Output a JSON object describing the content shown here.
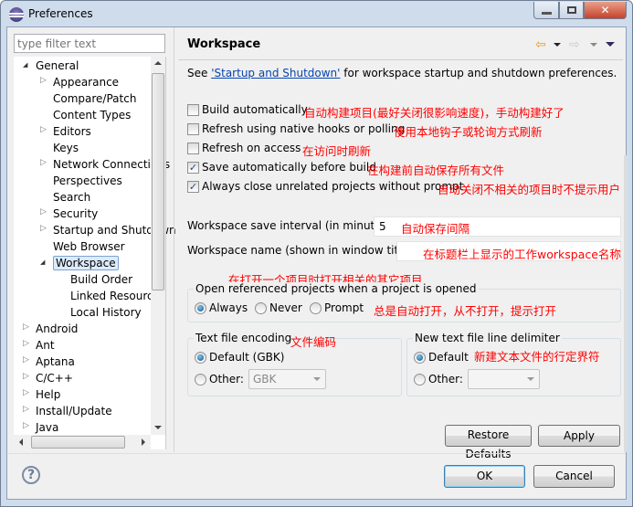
{
  "window": {
    "title": "Preferences",
    "minimize": "minimize",
    "maximize": "maximize",
    "close": "close"
  },
  "sidebar": {
    "filter_placeholder": "type filter text",
    "items": [
      {
        "label": "General",
        "level": 0,
        "expander": "expanded"
      },
      {
        "label": "Appearance",
        "level": 1,
        "expander": "collapsed"
      },
      {
        "label": "Compare/Patch",
        "level": 1,
        "expander": "none"
      },
      {
        "label": "Content Types",
        "level": 1,
        "expander": "none"
      },
      {
        "label": "Editors",
        "level": 1,
        "expander": "collapsed"
      },
      {
        "label": "Keys",
        "level": 1,
        "expander": "none"
      },
      {
        "label": "Network Connections",
        "level": 1,
        "expander": "collapsed"
      },
      {
        "label": "Perspectives",
        "level": 1,
        "expander": "none"
      },
      {
        "label": "Search",
        "level": 1,
        "expander": "none"
      },
      {
        "label": "Security",
        "level": 1,
        "expander": "collapsed"
      },
      {
        "label": "Startup and Shutdown",
        "level": 1,
        "expander": "collapsed"
      },
      {
        "label": "Web Browser",
        "level": 1,
        "expander": "none"
      },
      {
        "label": "Workspace",
        "level": 1,
        "expander": "expanded",
        "selected": true
      },
      {
        "label": "Build Order",
        "level": 2,
        "expander": "none"
      },
      {
        "label": "Linked Resources",
        "level": 2,
        "expander": "none"
      },
      {
        "label": "Local History",
        "level": 2,
        "expander": "none"
      },
      {
        "label": "Android",
        "level": 0,
        "expander": "collapsed"
      },
      {
        "label": "Ant",
        "level": 0,
        "expander": "collapsed"
      },
      {
        "label": "Aptana",
        "level": 0,
        "expander": "collapsed"
      },
      {
        "label": "C/C++",
        "level": 0,
        "expander": "collapsed"
      },
      {
        "label": "Help",
        "level": 0,
        "expander": "collapsed"
      },
      {
        "label": "Install/Update",
        "level": 0,
        "expander": "collapsed"
      },
      {
        "label": "Java",
        "level": 0,
        "expander": "collapsed"
      }
    ]
  },
  "page": {
    "title": "Workspace",
    "intro_prefix": "See ",
    "intro_link": "'Startup and Shutdown'",
    "intro_suffix": " for workspace startup and shutdown preferences.",
    "checkboxes": [
      {
        "label": "Build automatically",
        "checked": false,
        "note": "自动构建项目(最好关闭很影响速度)，手动构建好了"
      },
      {
        "label": "Refresh using native hooks or polling",
        "checked": false,
        "note": "使用本地钩子或轮询方式刷新"
      },
      {
        "label": "Refresh on access",
        "checked": false,
        "note": "在访问时刷新"
      },
      {
        "label": "Save automatically before build",
        "checked": true,
        "note": "在构建前自动保存所有文件"
      },
      {
        "label": "Always close unrelated projects without prompt",
        "checked": true,
        "note": "自动关闭不相关的项目时不提示用户"
      }
    ],
    "save_interval": {
      "label": "Workspace save interval (in minutes):",
      "value": "5",
      "note": "自动保存间隔"
    },
    "workspace_name": {
      "label": "Workspace name (shown in window title):",
      "value": "",
      "note": "在标题栏上显示的工作workspace名称"
    },
    "open_ref": {
      "note": "在打开一个项目时打开相关的其它项目",
      "title": "Open referenced projects when a project is opened",
      "options": [
        "Always",
        "Never",
        "Prompt"
      ],
      "selected": "Always",
      "options_note": "总是自动打开，从不打开，提示打开"
    },
    "encoding": {
      "title": "Text file encoding",
      "note": "文件编码",
      "default_label": "Default (GBK)",
      "other_label": "Other:",
      "other_value": "GBK",
      "selected": "default"
    },
    "delimiter": {
      "title": "New text file line delimiter",
      "note": "新建文本文件的行定界符",
      "default_label": "Default",
      "other_label": "Other:",
      "other_value": "",
      "selected": "default"
    },
    "restore_defaults": "Restore Defaults",
    "apply": "Apply"
  },
  "footer": {
    "ok": "OK",
    "cancel": "Cancel",
    "help_icon": "question-mark"
  },
  "colors": {
    "annotation": "#ff0000",
    "link": "#0645ad",
    "selection": "#dcebfc"
  }
}
